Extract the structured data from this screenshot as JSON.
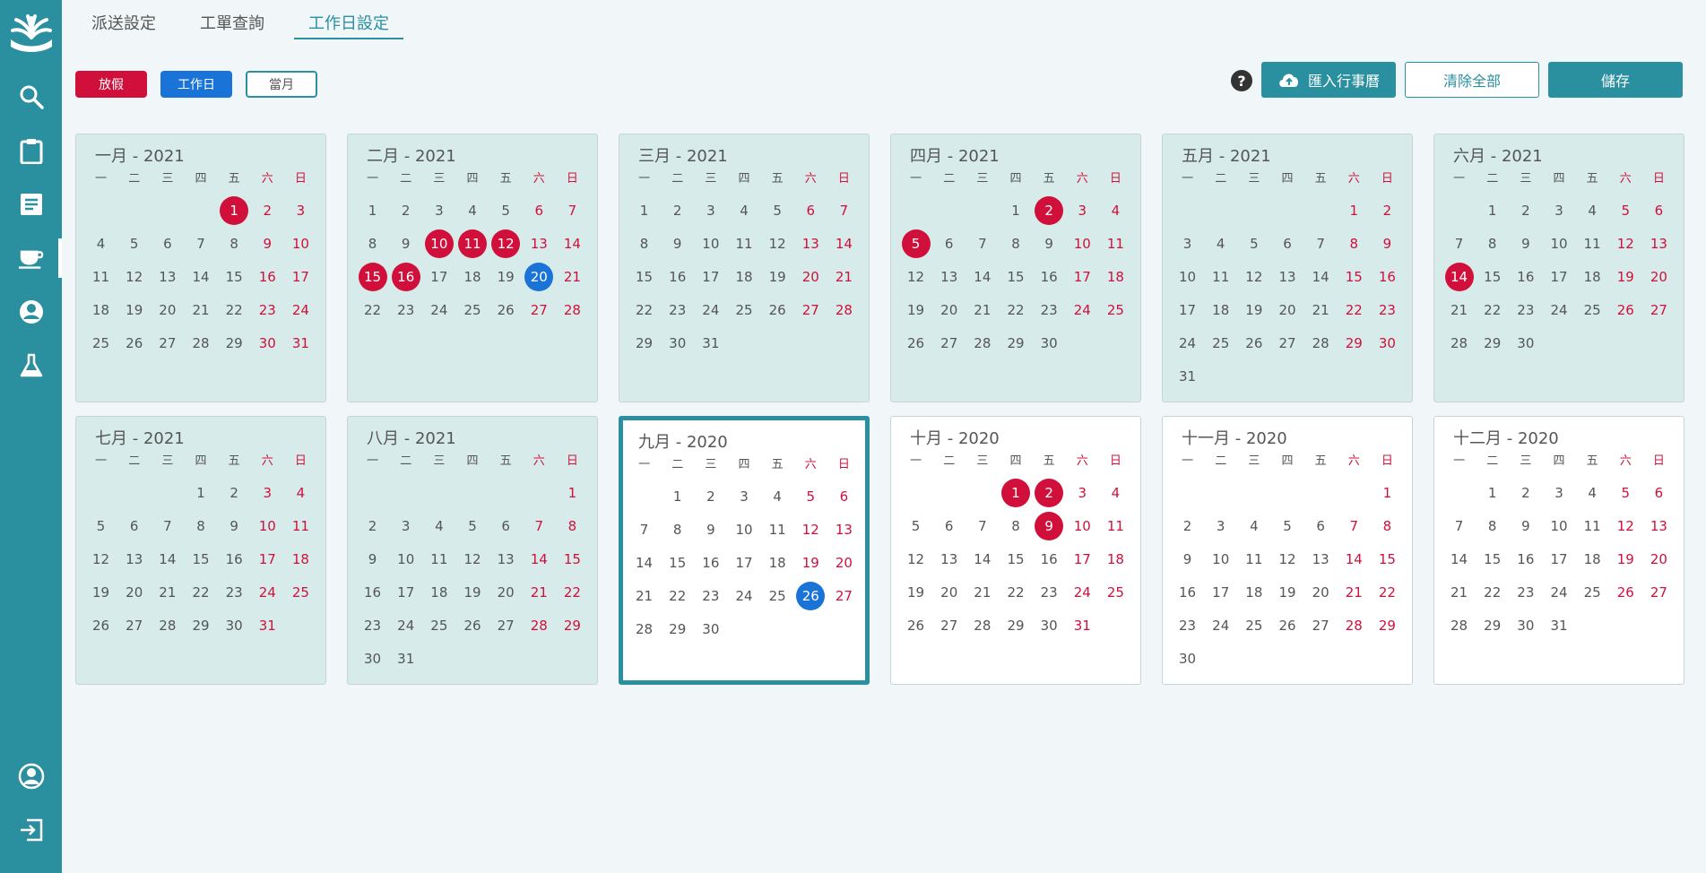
{
  "tabs": [
    {
      "label": "派送設定",
      "active": false
    },
    {
      "label": "工單查詢",
      "active": false
    },
    {
      "label": "工作日設定",
      "active": true
    }
  ],
  "legend": {
    "holiday": "放假",
    "workday": "工作日",
    "current": "當月"
  },
  "actions": {
    "help": "?",
    "import": "匯入行事曆",
    "clear": "清除全部",
    "save": "儲存"
  },
  "colors": {
    "accent": "#2a8f9f",
    "holiday": "#d0103a",
    "workday": "#1a74d8"
  },
  "sidebar": {
    "icons": [
      "logo-icon",
      "search-icon",
      "clipboard-icon",
      "document-icon",
      "coffee-icon",
      "user-icon",
      "flask-icon",
      "account-icon",
      "logout-icon"
    ]
  },
  "weekdays": [
    "一",
    "二",
    "三",
    "四",
    "五",
    "六",
    "日"
  ],
  "months": [
    {
      "title": "一月 - 2021",
      "state": "shaded",
      "offset": 4,
      "days": 31,
      "holidays": [
        1
      ],
      "workdays": []
    },
    {
      "title": "二月 - 2021",
      "state": "shaded",
      "offset": 0,
      "days": 28,
      "holidays": [
        10,
        11,
        12,
        15,
        16
      ],
      "workdays": [
        20
      ]
    },
    {
      "title": "三月 - 2021",
      "state": "shaded",
      "offset": 0,
      "days": 31,
      "holidays": [],
      "workdays": []
    },
    {
      "title": "四月 - 2021",
      "state": "shaded",
      "offset": 3,
      "days": 30,
      "holidays": [
        2,
        5
      ],
      "workdays": []
    },
    {
      "title": "五月 - 2021",
      "state": "shaded",
      "offset": 5,
      "days": 31,
      "holidays": [],
      "workdays": []
    },
    {
      "title": "六月 - 2021",
      "state": "shaded",
      "offset": 1,
      "days": 30,
      "holidays": [
        14
      ],
      "workdays": []
    },
    {
      "title": "七月 - 2021",
      "state": "shaded",
      "offset": 3,
      "days": 31,
      "holidays": [],
      "workdays": []
    },
    {
      "title": "八月 - 2021",
      "state": "shaded",
      "offset": 6,
      "days": 31,
      "holidays": [],
      "workdays": []
    },
    {
      "title": "九月 - 2020",
      "state": "current",
      "offset": 1,
      "days": 30,
      "holidays": [],
      "workdays": [
        26
      ]
    },
    {
      "title": "十月 - 2020",
      "state": "plain",
      "offset": 3,
      "days": 31,
      "holidays": [
        1,
        2,
        9
      ],
      "workdays": []
    },
    {
      "title": "十一月 - 2020",
      "state": "plain",
      "offset": 6,
      "days": 30,
      "holidays": [],
      "workdays": []
    },
    {
      "title": "十二月 - 2020",
      "state": "plain",
      "offset": 1,
      "days": 31,
      "holidays": [],
      "workdays": []
    }
  ]
}
